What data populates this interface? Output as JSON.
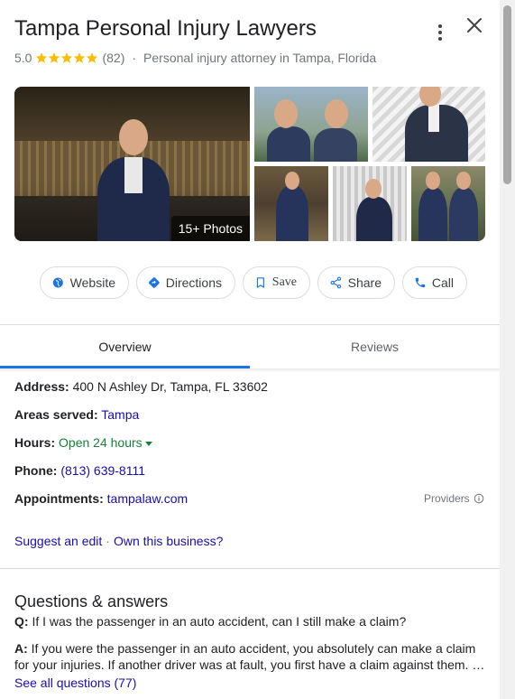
{
  "header": {
    "title": "Tampa Personal Injury Lawyers",
    "rating": "5.0",
    "stars": 5,
    "star_color": "#fbbc04",
    "review_count": "(82)",
    "separator": "·",
    "category": "Personal injury attorney in Tampa, Florida"
  },
  "photos": {
    "count_label": "15+ Photos"
  },
  "actions": {
    "website": "Website",
    "directions": "Directions",
    "save": "Save",
    "share": "Share",
    "call": "Call"
  },
  "tabs": {
    "overview": "Overview",
    "reviews": "Reviews"
  },
  "details": {
    "address_label": "Address:",
    "address_value": "400 N Ashley Dr, Tampa, FL 33602",
    "areas_label": "Areas served:",
    "areas_value": "Tampa",
    "hours_label": "Hours:",
    "hours_value": "Open 24 hours",
    "phone_label": "Phone:",
    "phone_value": "(813) 639-8111",
    "appointments_label": "Appointments:",
    "appointments_value": "tampalaw.com",
    "providers": "Providers"
  },
  "suggest": {
    "edit": "Suggest an edit",
    "dot": "·",
    "own": "Own this business?"
  },
  "qa": {
    "title": "Questions & answers",
    "q_label": "Q:",
    "question": "If I was the passenger in an auto accident, can I still make a claim?",
    "a_label": "A:",
    "answer": "If you were the passenger in an auto accident, you absolutely can make a claim for your injuries. If another driver was at fault, you first have a claim against them. …",
    "see_all": "See all questions (77)"
  },
  "colors": {
    "link": "#1a0dab",
    "accent": "#1a73e8",
    "open": "#188038"
  }
}
